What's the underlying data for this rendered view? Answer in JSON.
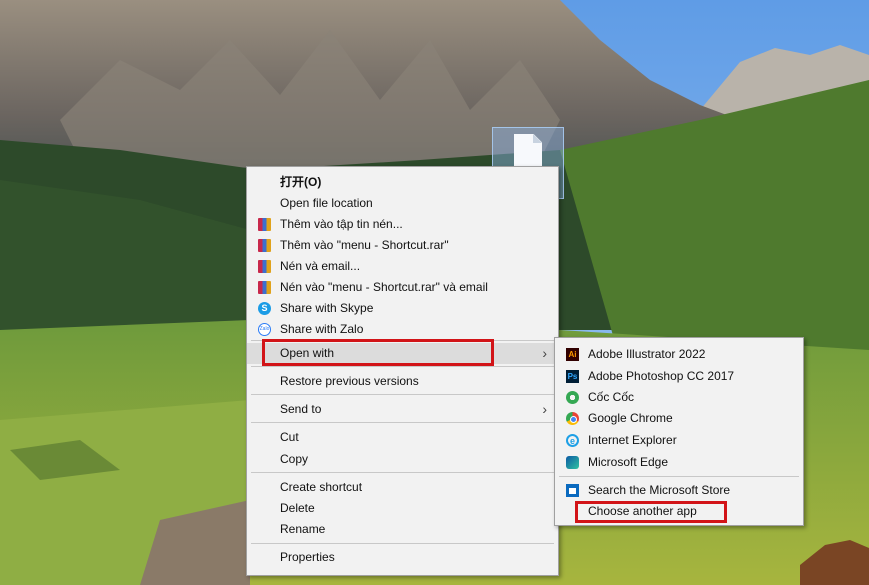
{
  "context_menu": {
    "items": [
      {
        "label": "打开(O)",
        "icon": ""
      },
      {
        "label": "Open file location",
        "icon": ""
      },
      {
        "label": "Thêm vào tập tin nén...",
        "icon": "winrar-icon"
      },
      {
        "label": "Thêm vào \"menu - Shortcut.rar\"",
        "icon": "winrar-icon"
      },
      {
        "label": "Nén và email...",
        "icon": "winrar-icon"
      },
      {
        "label": "Nén vào \"menu - Shortcut.rar\" và email",
        "icon": "winrar-icon"
      },
      {
        "label": "Share with Skype",
        "icon": "skype-icon"
      },
      {
        "label": "Share with Zalo",
        "icon": "zalo-icon"
      },
      {
        "label": "Open with",
        "icon": ""
      },
      {
        "label": "Restore previous versions",
        "icon": ""
      },
      {
        "label": "Send to",
        "icon": ""
      },
      {
        "label": "Cut",
        "icon": ""
      },
      {
        "label": "Copy",
        "icon": ""
      },
      {
        "label": "Create shortcut",
        "icon": ""
      },
      {
        "label": "Delete",
        "icon": ""
      },
      {
        "label": "Rename",
        "icon": ""
      },
      {
        "label": "Properties",
        "icon": ""
      }
    ],
    "arrow_glyph": "›"
  },
  "open_with_menu": {
    "apps": [
      {
        "label": "Adobe Illustrator 2022",
        "icon": "adobe-illustrator-icon",
        "glyph": "Ai"
      },
      {
        "label": "Adobe Photoshop CC 2017",
        "icon": "adobe-photoshop-icon",
        "glyph": "Ps"
      },
      {
        "label": "Cốc Cốc",
        "icon": "coccoc-icon",
        "glyph": ""
      },
      {
        "label": "Google Chrome",
        "icon": "chrome-icon",
        "glyph": ""
      },
      {
        "label": "Internet Explorer",
        "icon": "internet-explorer-icon",
        "glyph": "e"
      },
      {
        "label": "Microsoft Edge",
        "icon": "edge-icon",
        "glyph": ""
      }
    ],
    "search_store": "Search the Microsoft Store",
    "choose_another": "Choose another app"
  },
  "icon_glyphs": {
    "skype": "S",
    "zalo": "Zalo"
  },
  "colors": {
    "highlight_box": "#d21418",
    "menu_bg": "#f2f2f2"
  }
}
